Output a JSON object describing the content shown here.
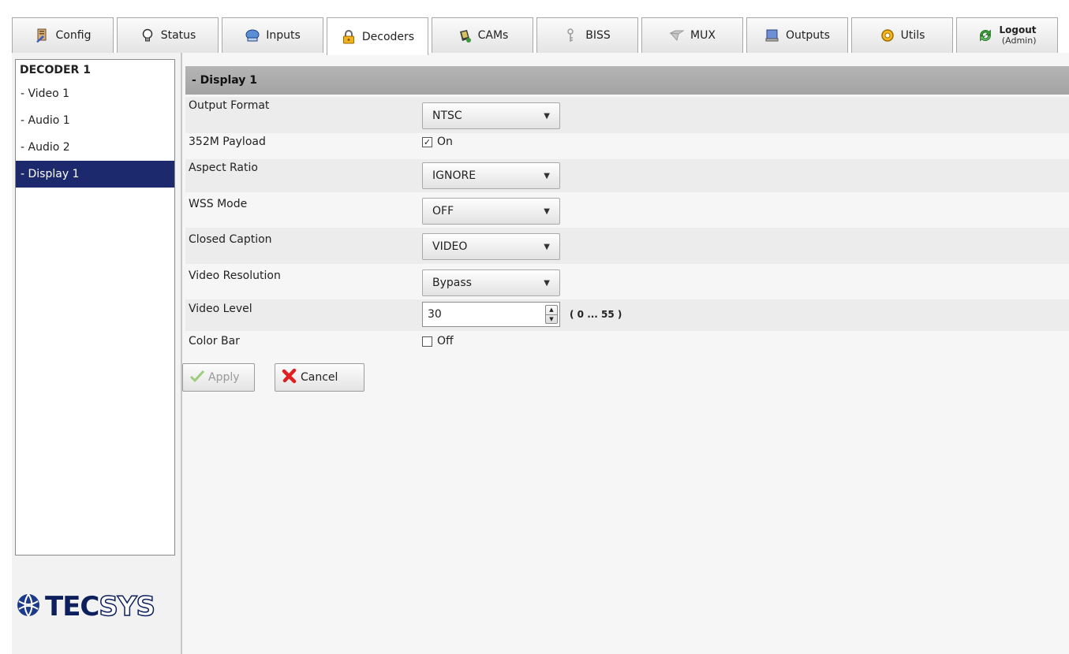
{
  "tabs": [
    {
      "label": "Config",
      "icon": "config-icon"
    },
    {
      "label": "Status",
      "icon": "bulb-icon"
    },
    {
      "label": "Inputs",
      "icon": "inputs-icon"
    },
    {
      "label": "Decoders",
      "icon": "lock-icon",
      "active": true
    },
    {
      "label": "CAMs",
      "icon": "cam-icon"
    },
    {
      "label": "BISS",
      "icon": "biss-icon"
    },
    {
      "label": "MUX",
      "icon": "mux-icon"
    },
    {
      "label": "Outputs",
      "icon": "outputs-icon"
    },
    {
      "label": "Utils",
      "icon": "utils-icon"
    }
  ],
  "logout": {
    "label": "Logout",
    "user": "(Admin)"
  },
  "sidebar": {
    "title": "DECODER 1",
    "items": [
      {
        "label": "- Video 1"
      },
      {
        "label": "- Audio 1"
      },
      {
        "label": "- Audio 2"
      },
      {
        "label": "- Display 1",
        "selected": true
      }
    ]
  },
  "logo": {
    "part1": "TEC",
    "part2": "SYS"
  },
  "section": {
    "title": "- Display 1"
  },
  "fields": {
    "output_format": {
      "label": "Output Format",
      "value": "NTSC"
    },
    "payload_352m": {
      "label": "352M Payload",
      "checked": true,
      "text": "On"
    },
    "aspect_ratio": {
      "label": "Aspect Ratio",
      "value": "IGNORE"
    },
    "wss_mode": {
      "label": "WSS Mode",
      "value": "OFF"
    },
    "closed_caption": {
      "label": "Closed Caption",
      "value": "VIDEO"
    },
    "video_resolution": {
      "label": "Video Resolution",
      "value": "Bypass"
    },
    "video_level": {
      "label": "Video Level",
      "value": "30",
      "range": "( 0 ... 55 )"
    },
    "color_bar": {
      "label": "Color Bar",
      "checked": false,
      "text": "Off"
    }
  },
  "actions": {
    "apply": "Apply",
    "cancel": "Cancel"
  },
  "colors": {
    "selected_nav": "#1c2a6d",
    "header_bar": "#a8a8a8",
    "cancel_red": "#e02020",
    "apply_green": "#8ac46a"
  }
}
